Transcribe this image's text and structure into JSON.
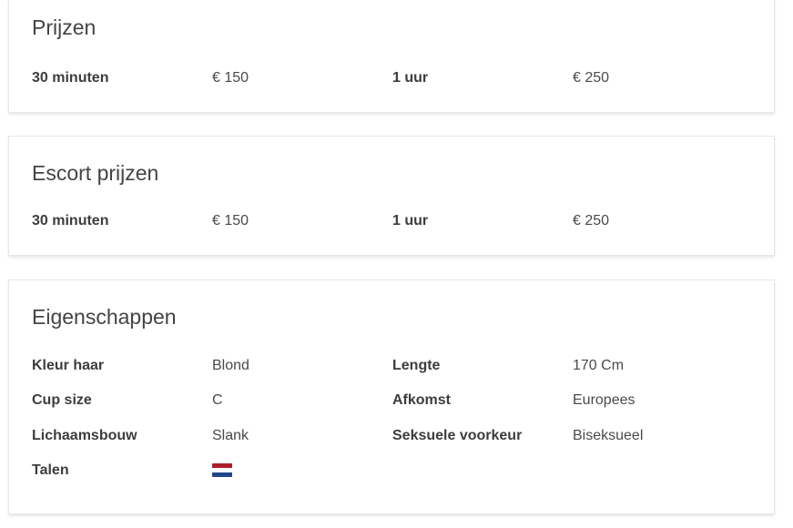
{
  "prijzen": {
    "title": "Prijzen",
    "rows": [
      {
        "label1": "30 minuten",
        "value1": "€ 150",
        "label2": "1 uur",
        "value2": "€ 250"
      }
    ]
  },
  "escort_prijzen": {
    "title": "Escort prijzen",
    "rows": [
      {
        "label1": "30 minuten",
        "value1": "€ 150",
        "label2": "1 uur",
        "value2": "€ 250"
      }
    ]
  },
  "eigenschappen": {
    "title": "Eigenschappen",
    "rows": [
      {
        "label1": "Kleur haar",
        "value1": "Blond",
        "label2": "Lengte",
        "value2": "170 Cm"
      },
      {
        "label1": "Cup size",
        "value1": "C",
        "label2": "Afkomst",
        "value2": "Europees"
      },
      {
        "label1": "Lichaamsbouw",
        "value1": "Slank",
        "label2": "Seksuele voorkeur",
        "value2": "Biseksueel"
      }
    ],
    "talen": {
      "label": "Talen",
      "flags": [
        {
          "icon": "flag-netherlands-icon",
          "colors": [
            "#ae1c28",
            "#ffffff",
            "#21468b"
          ]
        }
      ]
    }
  },
  "colors": {
    "text": "#3a3a3a",
    "card_border": "#e6e6e6"
  }
}
